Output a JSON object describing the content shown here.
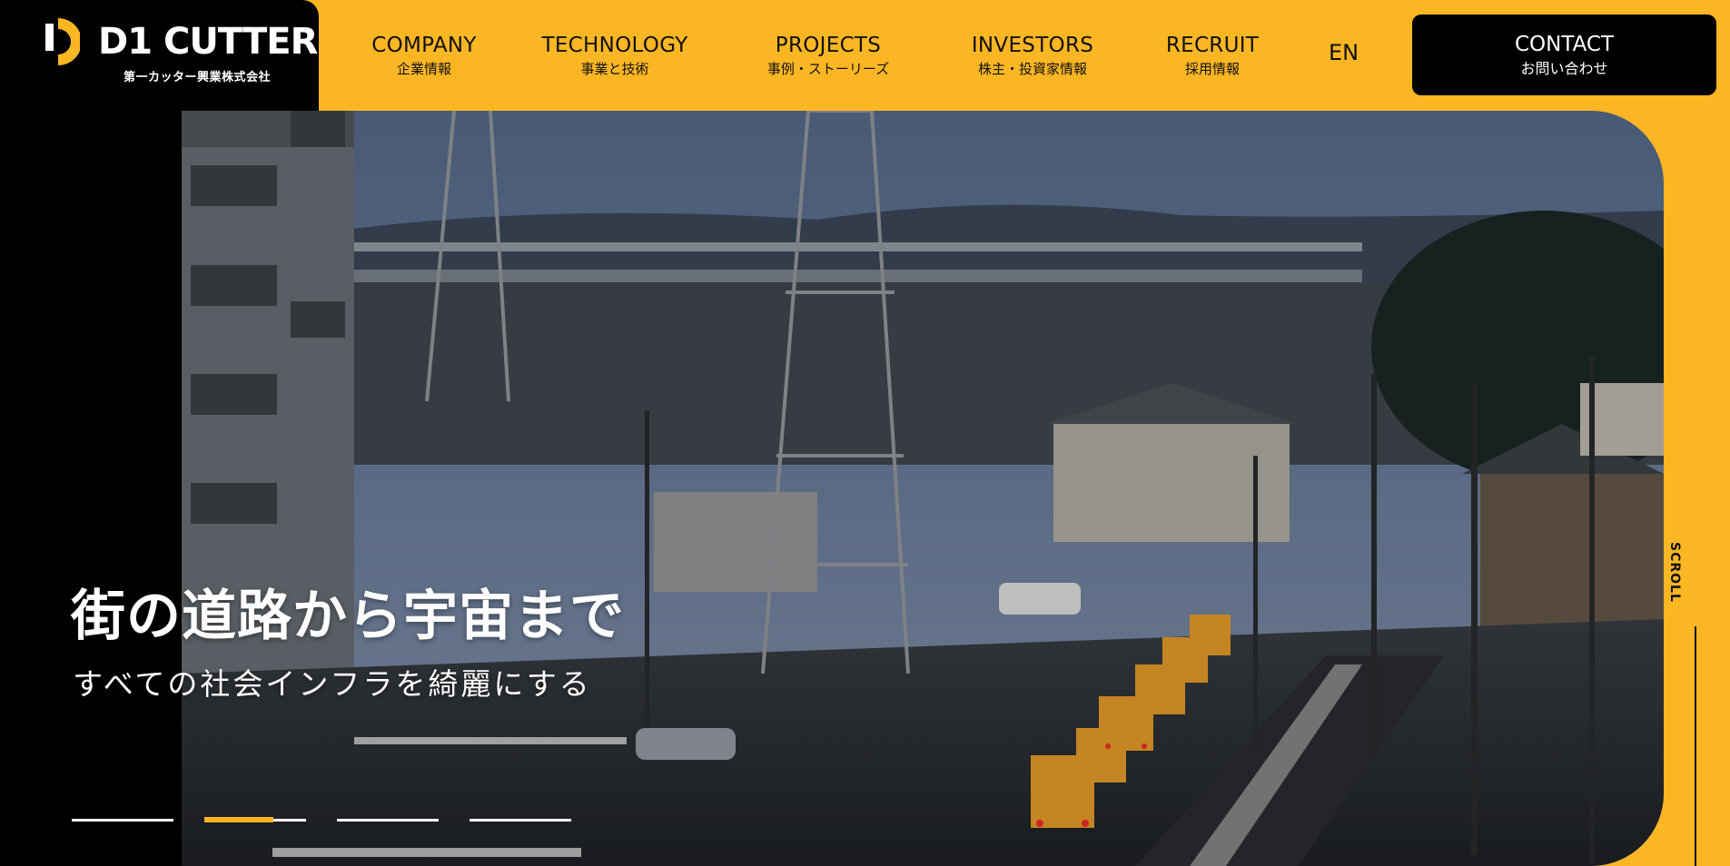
{
  "brand": {
    "name": "D1 CUTTER",
    "subtitle": "第一カッター興業株式会社"
  },
  "nav": [
    {
      "en": "COMPANY",
      "ja": "企業情報"
    },
    {
      "en": "TECHNOLOGY",
      "ja": "事業と技術"
    },
    {
      "en": "PROJECTS",
      "ja": "事例・ストーリーズ"
    },
    {
      "en": "INVESTORS",
      "ja": "株主・投資家情報"
    },
    {
      "en": "RECRUIT",
      "ja": "採用情報"
    }
  ],
  "lang_label": "EN",
  "contact": {
    "en": "CONTACT",
    "ja": "お問い合わせ"
  },
  "hero": {
    "headline": "街の道路から宇宙まで",
    "subline": "すべての社会インフラを綺麗にする",
    "slides": 4,
    "active_slide_index": 1,
    "active_slide_progress": 0.68
  },
  "scroll_label": "SCROLL",
  "colors": {
    "accent": "#fbb623",
    "dark": "#000000",
    "text_light": "#ffffff"
  },
  "icons": {
    "logo": "d1-logo-mark"
  }
}
